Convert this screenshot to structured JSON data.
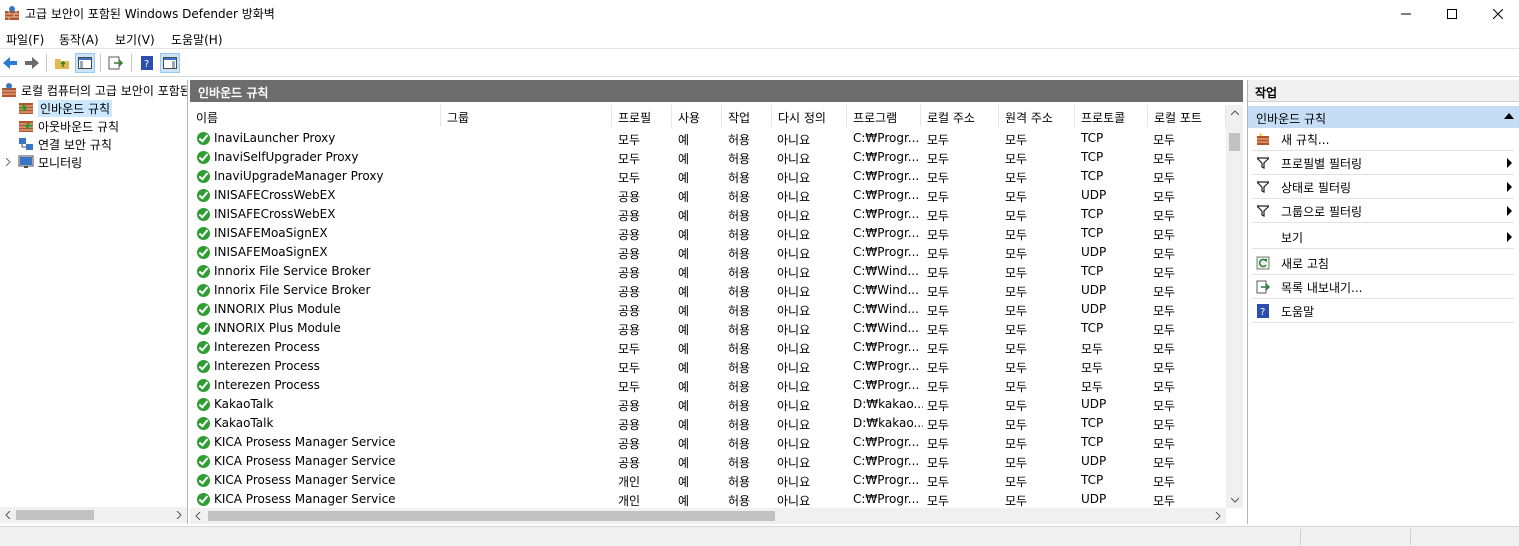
{
  "window": {
    "title": "고급 보안이 포함된 Windows Defender 방화벽"
  },
  "menu": [
    "파일(F)",
    "동작(A)",
    "보기(V)",
    "도움말(H)"
  ],
  "tree": {
    "root": "로컬 컴퓨터의 고급 보안이 포함된",
    "items": [
      "인바운드 규칙",
      "아웃바운드 규칙",
      "연결 보안 규칙",
      "모니터링"
    ]
  },
  "center": {
    "title": "인바운드 규칙",
    "columns": [
      "이름",
      "그룹",
      "프로필",
      "사용",
      "작업",
      "다시 정의",
      "프로그램",
      "로컬 주소",
      "원격 주소",
      "프로토콜",
      "로컬 포트"
    ],
    "rows": [
      [
        "InaviLauncher Proxy",
        "",
        "모두",
        "예",
        "허용",
        "아니요",
        "C:₩Progr...",
        "모두",
        "모두",
        "TCP",
        "모두"
      ],
      [
        "InaviSelfUpgrader Proxy",
        "",
        "모두",
        "예",
        "허용",
        "아니요",
        "C:₩Progr...",
        "모두",
        "모두",
        "TCP",
        "모두"
      ],
      [
        "InaviUpgradeManager Proxy",
        "",
        "모두",
        "예",
        "허용",
        "아니요",
        "C:₩Progr...",
        "모두",
        "모두",
        "TCP",
        "모두"
      ],
      [
        "INISAFECrossWebEX",
        "",
        "공용",
        "예",
        "허용",
        "아니요",
        "C:₩Progr...",
        "모두",
        "모두",
        "UDP",
        "모두"
      ],
      [
        "INISAFECrossWebEX",
        "",
        "공용",
        "예",
        "허용",
        "아니요",
        "C:₩Progr...",
        "모두",
        "모두",
        "TCP",
        "모두"
      ],
      [
        "INISAFEMoaSignEX",
        "",
        "공용",
        "예",
        "허용",
        "아니요",
        "C:₩Progr...",
        "모두",
        "모두",
        "TCP",
        "모두"
      ],
      [
        "INISAFEMoaSignEX",
        "",
        "공용",
        "예",
        "허용",
        "아니요",
        "C:₩Progr...",
        "모두",
        "모두",
        "UDP",
        "모두"
      ],
      [
        "Innorix File Service Broker",
        "",
        "공용",
        "예",
        "허용",
        "아니요",
        "C:₩Wind...",
        "모두",
        "모두",
        "TCP",
        "모두"
      ],
      [
        "Innorix File Service Broker",
        "",
        "공용",
        "예",
        "허용",
        "아니요",
        "C:₩Wind...",
        "모두",
        "모두",
        "UDP",
        "모두"
      ],
      [
        "INNORIX Plus Module",
        "",
        "공용",
        "예",
        "허용",
        "아니요",
        "C:₩Wind...",
        "모두",
        "모두",
        "UDP",
        "모두"
      ],
      [
        "INNORIX Plus Module",
        "",
        "공용",
        "예",
        "허용",
        "아니요",
        "C:₩Wind...",
        "모두",
        "모두",
        "TCP",
        "모두"
      ],
      [
        "Interezen Process",
        "",
        "모두",
        "예",
        "허용",
        "아니요",
        "C:₩Progr...",
        "모두",
        "모두",
        "모두",
        "모두"
      ],
      [
        "Interezen Process",
        "",
        "모두",
        "예",
        "허용",
        "아니요",
        "C:₩Progr...",
        "모두",
        "모두",
        "모두",
        "모두"
      ],
      [
        "Interezen Process",
        "",
        "모두",
        "예",
        "허용",
        "아니요",
        "C:₩Progr...",
        "모두",
        "모두",
        "모두",
        "모두"
      ],
      [
        "KakaoTalk",
        "",
        "공용",
        "예",
        "허용",
        "아니요",
        "D:₩kakao...",
        "모두",
        "모두",
        "UDP",
        "모두"
      ],
      [
        "KakaoTalk",
        "",
        "공용",
        "예",
        "허용",
        "아니요",
        "D:₩kakao...",
        "모두",
        "모두",
        "TCP",
        "모두"
      ],
      [
        "KICA Prosess Manager Service",
        "",
        "공용",
        "예",
        "허용",
        "아니요",
        "C:₩Progr...",
        "모두",
        "모두",
        "TCP",
        "모두"
      ],
      [
        "KICA Prosess Manager Service",
        "",
        "공용",
        "예",
        "허용",
        "아니요",
        "C:₩Progr...",
        "모두",
        "모두",
        "UDP",
        "모두"
      ],
      [
        "KICA Prosess Manager Service",
        "",
        "개인",
        "예",
        "허용",
        "아니요",
        "C:₩Progr...",
        "모두",
        "모두",
        "TCP",
        "모두"
      ],
      [
        "KICA Prosess Manager Service",
        "",
        "개인",
        "예",
        "허용",
        "아니요",
        "C:₩Progr...",
        "모두",
        "모두",
        "UDP",
        "모두"
      ]
    ]
  },
  "actions": {
    "header": "작업",
    "section": "인바운드 규칙",
    "items": [
      {
        "label": "새 규칙...",
        "icon": "new-rule-icon",
        "submenu": false
      },
      {
        "label": "프로필별 필터링",
        "icon": "filter-icon",
        "submenu": true
      },
      {
        "label": "상태로 필터링",
        "icon": "filter-icon",
        "submenu": true
      },
      {
        "label": "그룹으로 필터링",
        "icon": "filter-icon",
        "submenu": true
      },
      {
        "label": "보기",
        "icon": "",
        "submenu": true
      },
      {
        "label": "새로 고침",
        "icon": "refresh-icon",
        "submenu": false
      },
      {
        "label": "목록 내보내기...",
        "icon": "export-icon",
        "submenu": false
      },
      {
        "label": "도움말",
        "icon": "help-icon",
        "submenu": false
      }
    ]
  }
}
